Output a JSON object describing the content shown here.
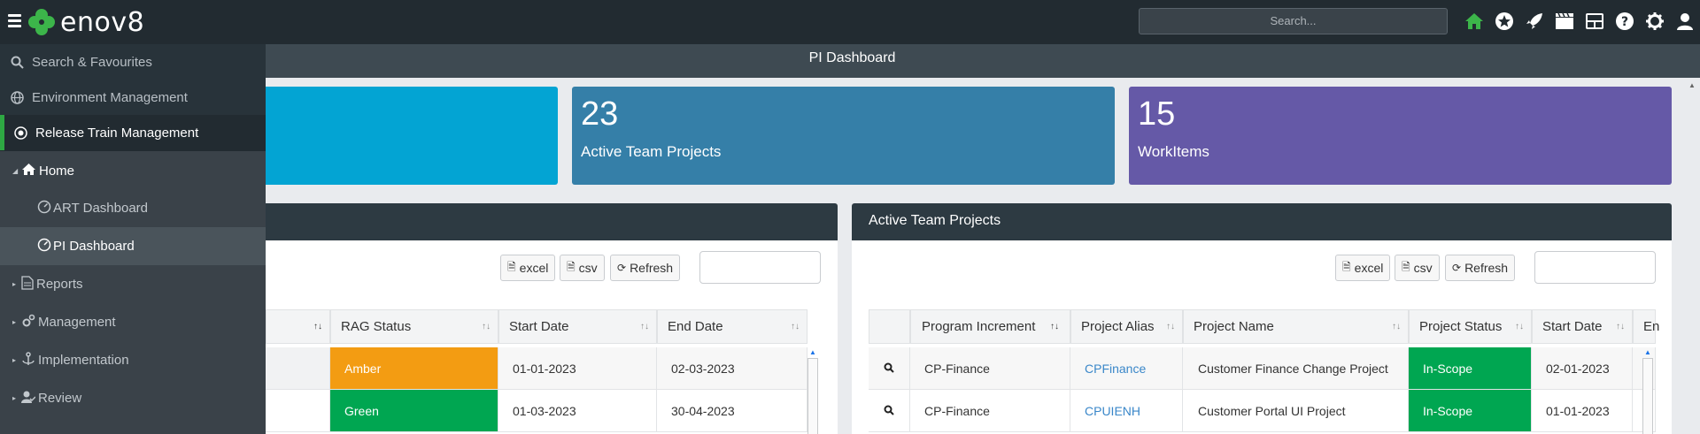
{
  "topbar": {
    "logo_text": "enov8",
    "search_placeholder": "Search...",
    "icons": [
      "home-icon",
      "star-icon",
      "rocket-icon",
      "clapperboard-icon",
      "dashboard-icon",
      "help-icon",
      "gear-icon",
      "user-icon"
    ],
    "accent": "#3cb54a"
  },
  "page_header": {
    "title": "PI Dashboard"
  },
  "cards": [
    {
      "value": "",
      "label": "",
      "color": "#03a4d3"
    },
    {
      "value": "23",
      "label": "Active Team Projects",
      "color": "#357fa8"
    },
    {
      "value": "15",
      "label": "WorkItems",
      "color": "#6559a7"
    }
  ],
  "panel_left": {
    "buttons": {
      "excel": "excel",
      "csv": "csv",
      "refresh": "Refresh"
    },
    "columns": [
      "RAG Status",
      "Start Date",
      "End Date"
    ],
    "rows": [
      {
        "rag": "Amber",
        "rag_color": "#f39c12",
        "start": "01-01-2023",
        "end": "02-03-2023"
      },
      {
        "rag": "Green",
        "rag_color": "#00a651",
        "start": "01-03-2023",
        "end": "30-04-2023"
      }
    ]
  },
  "panel_right": {
    "title": "Active Team Projects",
    "buttons": {
      "excel": "excel",
      "csv": "csv",
      "refresh": "Refresh"
    },
    "columns": [
      "Program Increment",
      "Project Alias",
      "Project Name",
      "Project Status",
      "Start Date",
      "En"
    ],
    "rows": [
      {
        "pi": "CP-Finance",
        "alias": "CPFinance",
        "name": "Customer Finance Change Project",
        "status": "In-Scope",
        "start": "02-01-2023"
      },
      {
        "pi": "CP-Finance",
        "alias": "CPUIENH",
        "name": "Customer Portal UI Project",
        "status": "In-Scope",
        "start": "01-01-2023"
      }
    ],
    "status_color": "#00a651",
    "link_color": "#3a87c9"
  },
  "sidemenu": {
    "top": [
      {
        "label": "Search & Favourites",
        "icon": "search-icon"
      },
      {
        "label": "Environment Management",
        "icon": "globe-icon"
      },
      {
        "label": "Release Train Management",
        "icon": "target-icon"
      }
    ],
    "home": {
      "label": "Home",
      "icon": "house-icon"
    },
    "home_children": [
      {
        "label": "ART Dashboard",
        "icon": "speedometer-icon"
      },
      {
        "label": "PI Dashboard",
        "icon": "speedometer-icon"
      }
    ],
    "sections": [
      {
        "label": "Reports",
        "icon": "document-icon"
      },
      {
        "label": "Management",
        "icon": "cogs-icon"
      },
      {
        "label": "Implementation",
        "icon": "anchor-icon"
      },
      {
        "label": "Review",
        "icon": "user-check-icon"
      }
    ]
  }
}
